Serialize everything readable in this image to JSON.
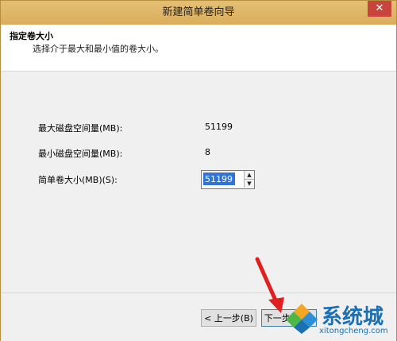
{
  "window": {
    "title": "新建简单卷向导",
    "close_glyph": "✕"
  },
  "header": {
    "title": "指定卷大小",
    "subtitle": "选择介于最大和最小值的卷大小。"
  },
  "fields": {
    "max_label": "最大磁盘空间量(MB):",
    "max_value": "51199",
    "min_label": "最小磁盘空间量(MB):",
    "min_value": "8",
    "size_label": "简单卷大小(MB)(S):",
    "size_value": "51199"
  },
  "spinner": {
    "up": "▲",
    "down": "▼"
  },
  "buttons": {
    "back": "< 上一步(B)",
    "next": "下一步(N) >"
  },
  "watermark": {
    "text": "系统城",
    "url": "xitongcheng.com"
  },
  "colors": {
    "titlebar": "#dcb262",
    "selection": "#3074d8",
    "arrow": "#e02020",
    "watermark": "#1b6fb3"
  }
}
